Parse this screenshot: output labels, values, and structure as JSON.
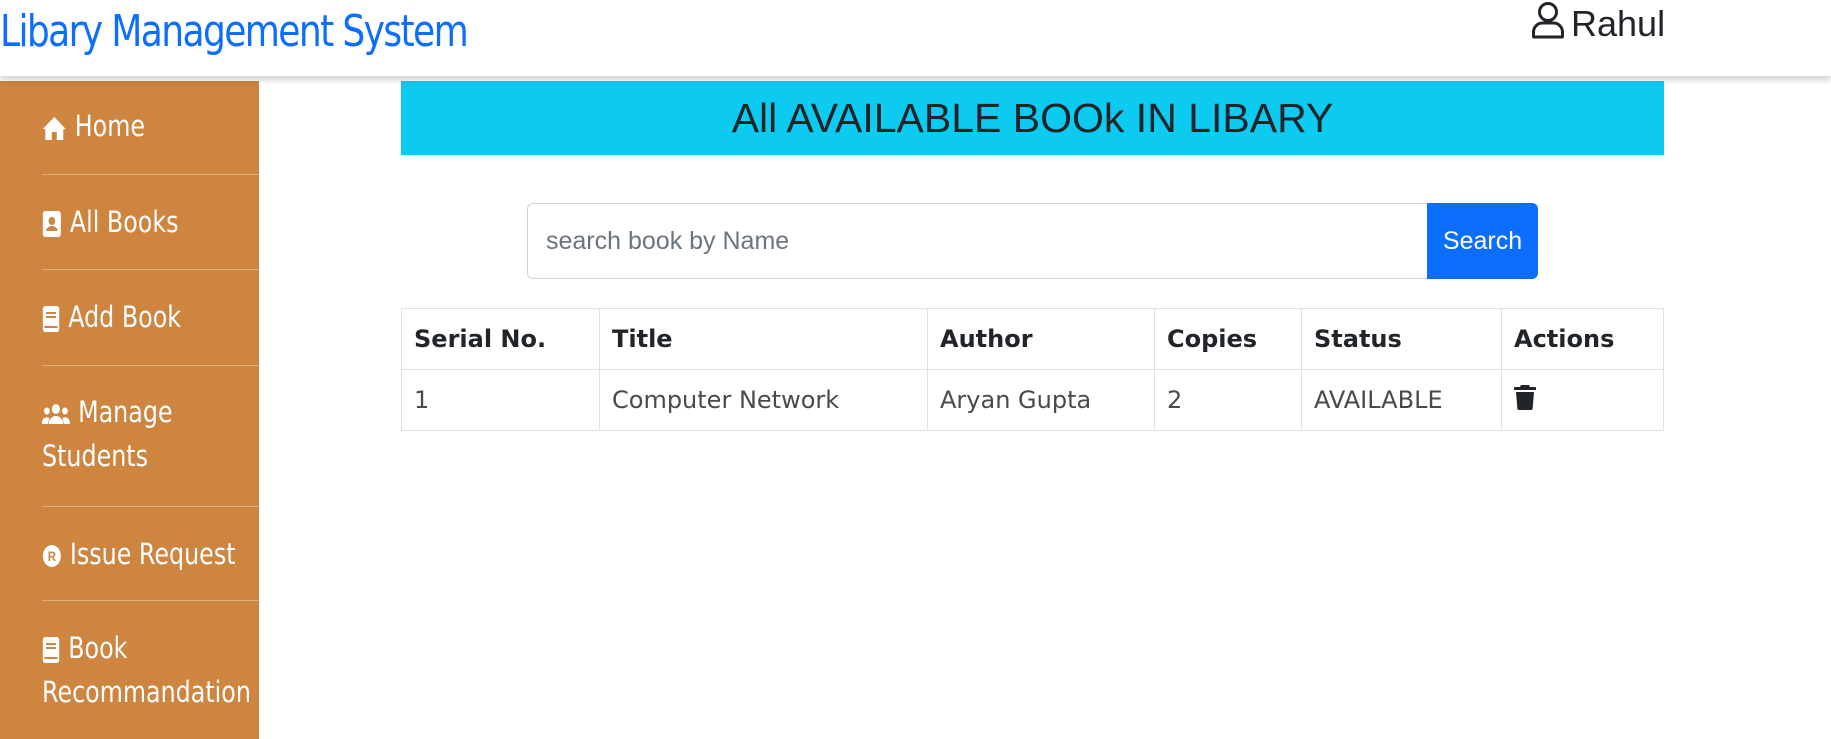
{
  "header": {
    "brand": "Libary Management System",
    "user_name": "Rahul",
    "user_icon": "user-icon"
  },
  "sidebar": {
    "items": [
      {
        "label": "Home",
        "icon": "home-icon"
      },
      {
        "label": "All Books",
        "icon": "address-book-icon"
      },
      {
        "label": "Add Book",
        "icon": "book-icon"
      },
      {
        "label_line1": "Manage",
        "label_line2": "Students",
        "icon": "users-icon"
      },
      {
        "label": "Issue Request",
        "icon": "registered-icon"
      },
      {
        "label_line1": "Book",
        "label_line2": "Recommandation",
        "icon": "book-icon"
      }
    ]
  },
  "main": {
    "banner": "All AVAILABLE BOOk IN LIBARY",
    "search": {
      "placeholder": "search book by Name",
      "value": "",
      "button_label": "Search"
    },
    "table": {
      "headers": [
        "Serial No.",
        "Title",
        "Author",
        "Copies",
        "Status",
        "Actions"
      ],
      "rows": [
        {
          "serial": "1",
          "title": "Computer Network",
          "author": "Aryan Gupta",
          "copies": "2",
          "status": "AVAILABLE",
          "action_icon": "trash-icon"
        }
      ]
    }
  },
  "colors": {
    "brand": "#0d6efd",
    "sidebar": "#cd853f",
    "banner": "#0dcaf0",
    "search_button": "#0d6efd"
  }
}
